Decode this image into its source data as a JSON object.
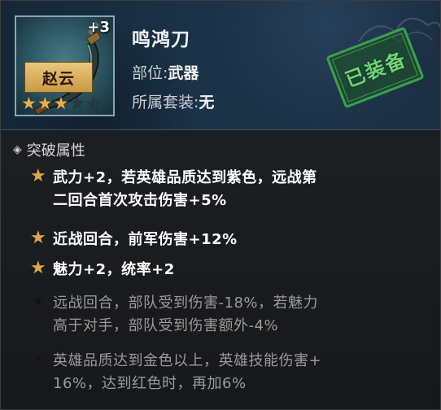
{
  "item": {
    "name": "鸣鸿刀",
    "enhance_level": "+3",
    "hero": "赵云",
    "stars": {
      "filled": 3,
      "total": 5
    },
    "slot_label": "部位:",
    "slot_value": "武器",
    "set_label": "所属套装:",
    "set_value": "无",
    "status_stamp": "已装备"
  },
  "section": {
    "title": "突破属性"
  },
  "attributes": [
    {
      "active": true,
      "lines": [
        "武力+2，若英雄品质达到紫色，远战第",
        "二回合首次攻击伤害+5%"
      ]
    },
    {
      "active": true,
      "lines": [
        "近战回合，前军伤害+12%"
      ]
    },
    {
      "active": true,
      "lines": [
        "魅力+2，统率+2"
      ]
    },
    {
      "active": false,
      "lines": [
        "远战回合，部队受到伤害-18%，若魅力",
        "高于对手，部队受到伤害额外-4%"
      ]
    },
    {
      "active": false,
      "lines": [
        "英雄品质达到金色以上，英雄技能伤害+",
        "16%，达到红色时，再加6%"
      ]
    }
  ],
  "colors": {
    "active_star": "#e0a64a",
    "inactive_text": "#9a9a9a",
    "stamp_green": "#3aa04a"
  }
}
